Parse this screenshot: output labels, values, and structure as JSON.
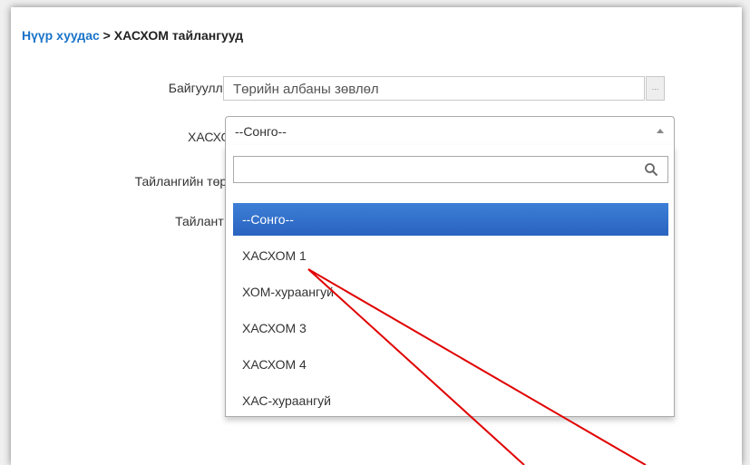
{
  "breadcrumb": {
    "home": "Нүүр хуудас",
    "separator": " > ",
    "current": "ХАСХОМ тайлангууд"
  },
  "form": {
    "org_label": "Байгууллага:",
    "org_value": "Төрийн албаны зөвлөл",
    "org_button": "...",
    "hashom_label": "ХАСХОМ:",
    "hashom_selected": "--Сонго--",
    "report_type_label": "Тайлангийн төрөл:",
    "report_year_label": "Тайлант он:"
  },
  "dropdown": {
    "search_value": "",
    "options": [
      "--Сонго--",
      "ХАСХОМ 1",
      "ХОМ-хураангуй",
      "ХАСХОМ 3",
      "ХАСХОМ 4",
      "ХАС-хураангуй"
    ],
    "selected_index": 0
  },
  "colors": {
    "link": "#1a73c9",
    "selected_option": "#2a63c0",
    "annotation_arrow": "#e00000"
  }
}
